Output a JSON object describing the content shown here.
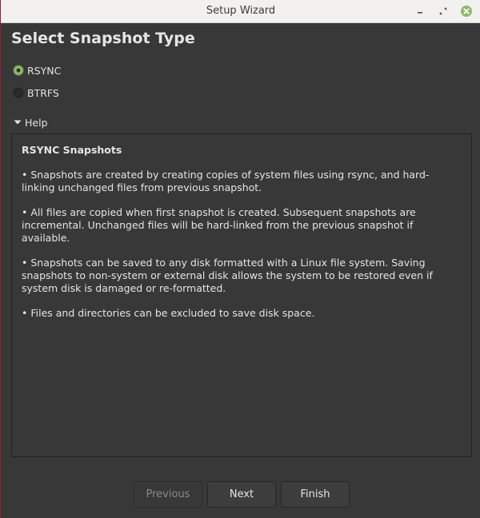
{
  "window": {
    "title": "Setup Wizard"
  },
  "page": {
    "title": "Select Snapshot Type"
  },
  "options": [
    {
      "label": "RSYNC",
      "selected": true
    },
    {
      "label": "BTRFS",
      "selected": false
    }
  ],
  "help": {
    "toggle_label": "Help",
    "expanded": true,
    "heading": "RSYNC Snapshots",
    "paragraphs": [
      "• Snapshots are created by creating copies of system files using rsync, and hard-linking unchanged files from previous snapshot.",
      "• All files are copied when first snapshot is created. Subsequent snapshots are incremental. Unchanged files will be hard-linked from the previous snapshot if available.",
      "• Snapshots can be saved to any disk formatted with a Linux file system. Saving snapshots to non-system or external disk allows the system to be restored even if system disk is damaged or re-formatted.",
      "• Files and directories can be excluded to save disk space."
    ]
  },
  "buttons": {
    "previous": "Previous",
    "next": "Next",
    "finish": "Finish"
  },
  "colors": {
    "accent": "#8fb86a",
    "background": "#383838",
    "titlebar": "#f2f1f0",
    "close": "#8fb86a"
  },
  "icons": {
    "minimize": "minimize-icon",
    "maximize": "maximize-icon",
    "close": "close-icon",
    "expander": "triangle-down-icon"
  }
}
